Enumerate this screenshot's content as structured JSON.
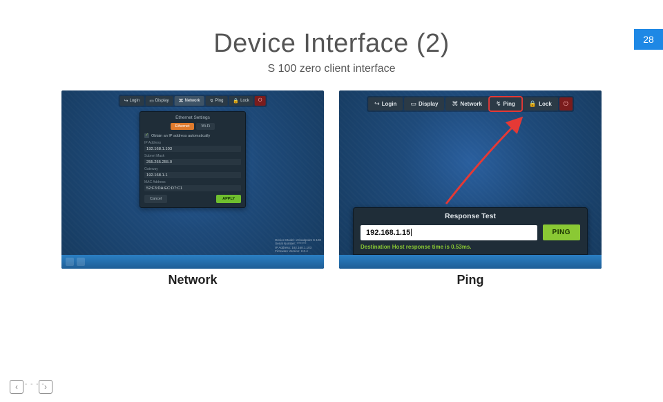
{
  "page_number": "28",
  "title": "Device Interface (2)",
  "subtitle": "S 100 zero client interface",
  "left": {
    "caption": "Network",
    "toolbar": [
      {
        "icon": "↪",
        "label": "Login"
      },
      {
        "icon": "▭",
        "label": "Display"
      },
      {
        "icon": "⌘",
        "label": "Network",
        "active": true
      },
      {
        "icon": "↯",
        "label": "Ping"
      },
      {
        "icon": "🔒",
        "label": "Lock"
      }
    ],
    "panel_title": "Ethernet Settings",
    "tabs": {
      "ethernet": "Ethernet",
      "wifi": "Wi-Fi"
    },
    "auto_ip": "Obtain an IP address automatically",
    "fields": {
      "ip": {
        "label": "IP Address",
        "value": "192.168.1.103"
      },
      "mask": {
        "label": "Subnet Mask",
        "value": "255.255.255.0"
      },
      "gateway": {
        "label": "Gateway",
        "value": "192.168.1.1"
      },
      "mac": {
        "label": "MAC Address",
        "value": "52:F3:DA:EC:D7:C1"
      }
    },
    "buttons": {
      "cancel": "Cancel",
      "apply": "APPLY"
    },
    "devinfo": [
      "Device Model: vCloudpoint S-100",
      "Serial Number: ********",
      "IP Address: 192.168.1.103",
      "Firmware Version: 2.0.4"
    ]
  },
  "right": {
    "caption": "Ping",
    "toolbar": [
      {
        "icon": "↪",
        "label": "Login"
      },
      {
        "icon": "▭",
        "label": "Display"
      },
      {
        "icon": "⌘",
        "label": "Network"
      },
      {
        "icon": "↯",
        "label": "Ping",
        "highlight": true
      },
      {
        "icon": "🔒",
        "label": "Lock"
      }
    ],
    "response": {
      "title": "Response Test",
      "input_value": "192.168.1.15",
      "ping_btn": "PING",
      "status": "Destination Host response time is 0.53ms."
    }
  },
  "nav": {
    "prev": "‹",
    "next": "›"
  }
}
